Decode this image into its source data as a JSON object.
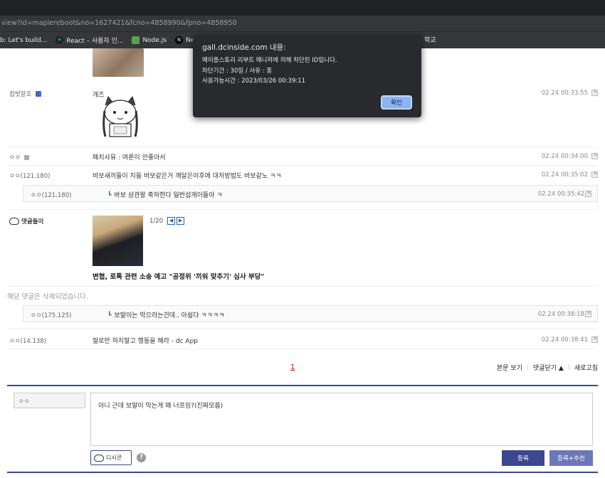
{
  "browser": {
    "url": "view?id=maplereboot&no=1627421&fcno=4858990&fpno=4858950",
    "bookmarks": [
      {
        "label": "b: Let's build...",
        "icon": "page-icon"
      },
      {
        "label": "React – 사용자 인...",
        "icon": "react-icon"
      },
      {
        "label": "Node.js",
        "icon": "nodejs-icon"
      },
      {
        "label": "Next.js",
        "icon": "nextjs-icon"
      }
    ],
    "bookmark_right": "학교"
  },
  "dialog": {
    "title": "gall.dcinside.com 내용:",
    "lines": [
      "메이플스토리 리부트 매니저에 의해 차단된 ID입니다.",
      "차단기간 : 30일 / 사유 : 퐁",
      "사용가능시간 : 2023/03/26 00:39:11"
    ],
    "ok_label": "확인"
  },
  "comments": [
    {
      "nick": "컵벗알조",
      "text": "개즈",
      "date": "02.24 00:33:55"
    },
    {
      "nick": "ㅇㅇ",
      "text": "패치사유 : 여론이 안좋아서",
      "date": "02.24 00:34:00"
    },
    {
      "nick": "ㅇㅇ(121.180)",
      "text": "바보새끼들이 지들 바보같은거 깨달은이후에 대처방법도 바보같노 ㅋㅋ",
      "date": "02.24 00:35:02"
    },
    {
      "nick": "ㅇㅇ(121.180)",
      "text": "바보 삼관왕 축하한다 일반섭게이들아 ㅋ",
      "date": "02.24 00:35:42"
    },
    {
      "nick": "댓글돌이",
      "pager": "1/20",
      "news_title": "변협, 로톡 관련 소송 예고 \"공정위 '끼워 맞추기' 심사 부당\""
    },
    {
      "text": "해당 댓글은 삭제되었습니다."
    },
    {
      "nick": "ㅇㅇ(175.125)",
      "text": "보말이는 막으라는건데.. 아쉽다 ㅋㅋㅋㅋ",
      "date": "02.24 00:38:18"
    },
    {
      "nick": "ㅇㅇ(14.138)",
      "text": "말로만 하지말고 행동을 해라 - dc App",
      "date": "02.24 00:38:41"
    }
  ],
  "pagination": {
    "current": "1"
  },
  "footer_links": {
    "view_post": "본문 보기",
    "close_comments": "댓글닫기 ▲",
    "refresh": "새로고침"
  },
  "write": {
    "nick_value": "ㅇㅇ",
    "memo_value": "아니 근데 보말이 막는게 왜 너프임?(진짜모름)",
    "dccon_label": "디시콘",
    "submit_label": "등록",
    "submit_recommend_label": "등록+추천"
  }
}
